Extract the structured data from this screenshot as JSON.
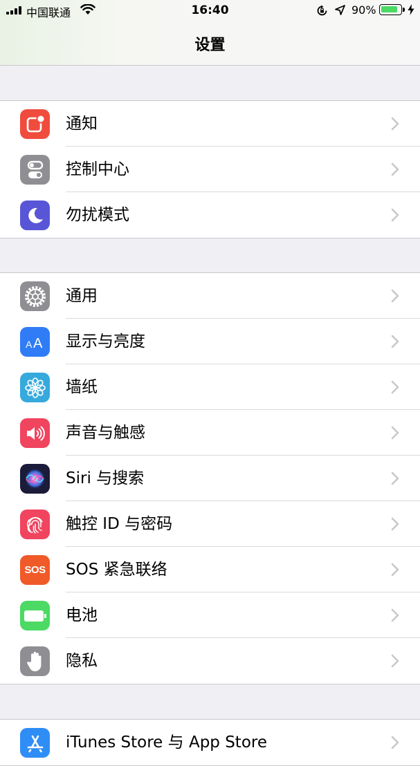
{
  "status_bar": {
    "carrier": "中国联通",
    "time": "16:40",
    "battery_percent": "90%",
    "battery_level": 0.9,
    "battery_color": "#4cd964"
  },
  "nav": {
    "title": "设置"
  },
  "groups": [
    {
      "items": [
        {
          "label": "通知",
          "icon": "notifications-icon",
          "color": "#f04c3e"
        },
        {
          "label": "控制中心",
          "icon": "control-center-icon",
          "color": "#8e8e93"
        },
        {
          "label": "勿扰模式",
          "icon": "moon-icon",
          "color": "#5856d6"
        }
      ]
    },
    {
      "items": [
        {
          "label": "通用",
          "icon": "gear-icon",
          "color": "#8e8e93"
        },
        {
          "label": "显示与亮度",
          "icon": "display-brightness-icon",
          "color": "#2f7cf6"
        },
        {
          "label": "墙纸",
          "icon": "wallpaper-flower-icon",
          "color": "#36aadc"
        },
        {
          "label": "声音与触感",
          "icon": "speaker-icon",
          "color": "#f0445f"
        },
        {
          "label": "Siri 与搜索",
          "icon": "siri-icon",
          "color": "#1b1b3a"
        },
        {
          "label": "触控 ID 与密码",
          "icon": "fingerprint-icon",
          "color": "#f0445f"
        },
        {
          "label": "SOS 紧急联络",
          "icon": "sos-icon",
          "color": "#f05a28",
          "icon_text": "SOS"
        },
        {
          "label": "电池",
          "icon": "battery-icon",
          "color": "#4cd964"
        },
        {
          "label": "隐私",
          "icon": "hand-icon",
          "color": "#8e8e93"
        }
      ]
    },
    {
      "items": [
        {
          "label": "iTunes Store 与 App Store",
          "icon": "app-store-icon",
          "color": "#2f8df6"
        }
      ]
    }
  ]
}
